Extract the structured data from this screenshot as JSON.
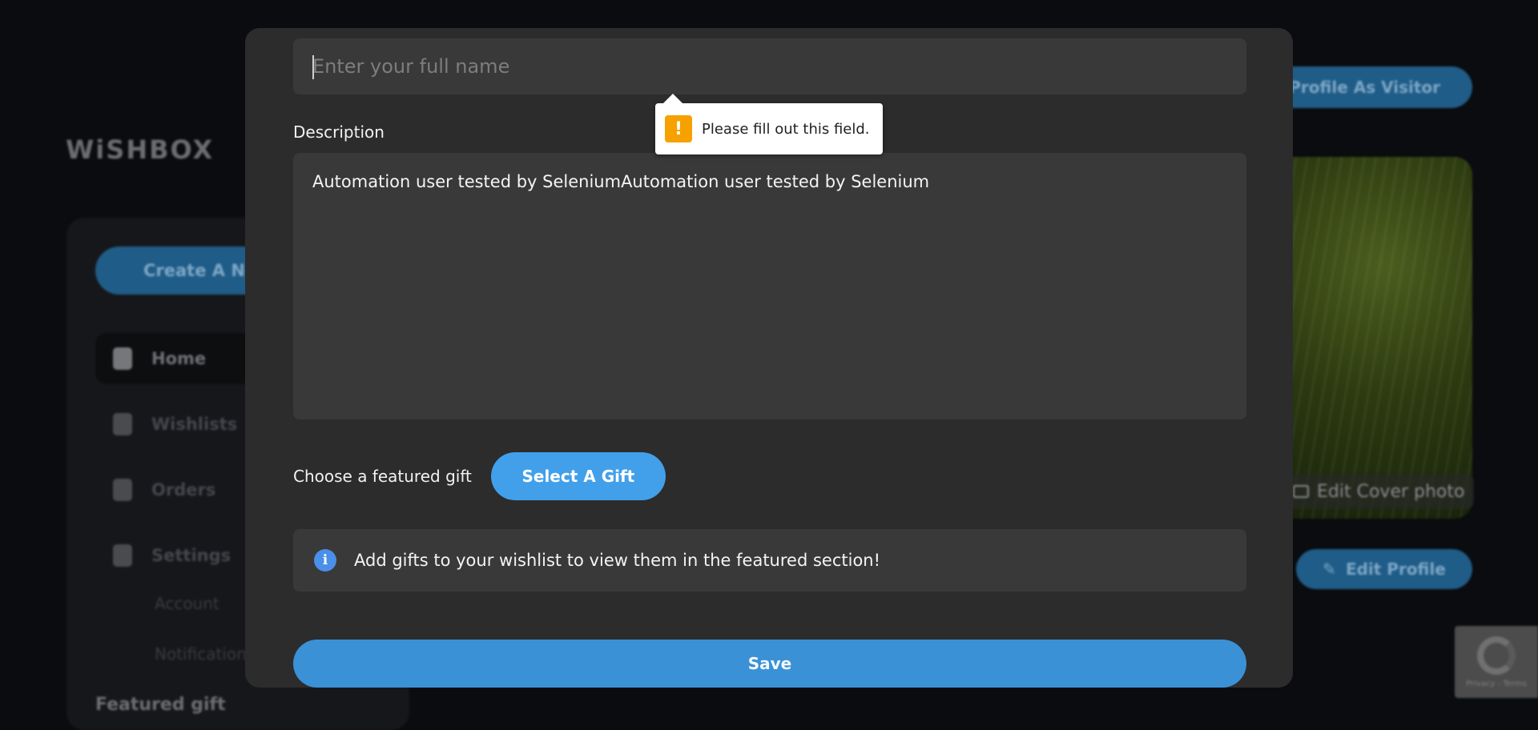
{
  "background": {
    "logo": "WiSHBOX",
    "create_button": "Create A Ne",
    "nav": [
      {
        "label": "Home",
        "icon": "clipboard-icon"
      },
      {
        "label": "Wishlists",
        "icon": "gift-list-icon"
      },
      {
        "label": "Orders",
        "icon": "box-icon"
      },
      {
        "label": "Settings",
        "icon": "gear-icon"
      }
    ],
    "subnav": [
      "Account",
      "Notification"
    ],
    "featured_label": "Featured gift",
    "view_visitor": "w Profile As Visitor",
    "edit_cover": "Edit Cover photo",
    "edit_profile": "Edit Profile",
    "recaptcha_text": "Privacy - Terms"
  },
  "modal": {
    "name_placeholder": "Enter your full name",
    "name_value": "",
    "description_label": "Description",
    "description_value": "Automation user tested by SeleniumAutomation user tested by Selenium",
    "choose_label": "Choose a featured gift",
    "select_gift": "Select A Gift",
    "info_text": "Add gifts to your wishlist to view them in the featured section!",
    "info_icon": "info-icon",
    "save": "Save"
  },
  "tooltip": {
    "text": "Please fill out this field.",
    "icon": "warning-icon",
    "icon_glyph": "!"
  },
  "colors": {
    "accent": "#42a0ea",
    "save": "#3a91d6",
    "modal_bg": "#2c2c2d",
    "field_bg": "#393939",
    "warning": "#f6a100"
  }
}
